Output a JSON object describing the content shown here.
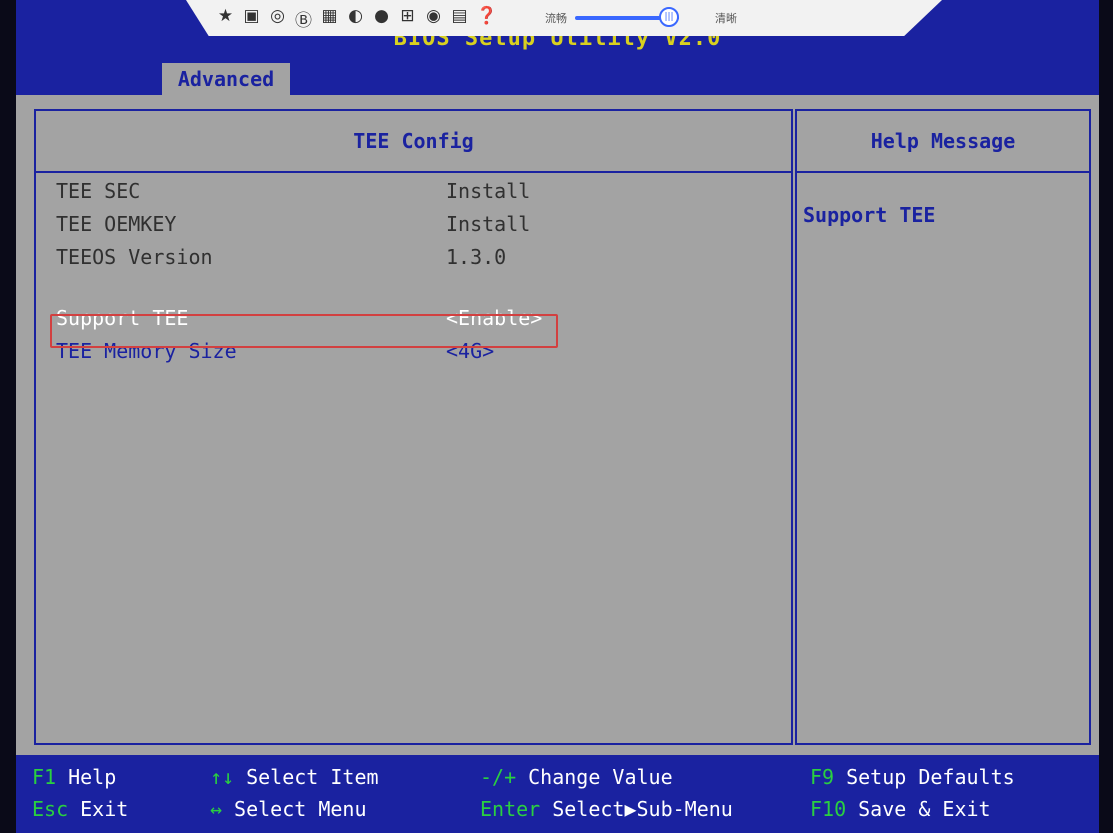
{
  "bios_title": "BIOS Setup Utility V2.0",
  "tab": "Advanced",
  "kvm": {
    "icons": [
      "pin-icon",
      "fullscreen-icon",
      "disc-icon",
      "b-icon",
      "keyboard-icon",
      "mouse-icon",
      "record-icon",
      "share-icon",
      "capture-icon",
      "screen-icon",
      "help-icon"
    ],
    "fluent_label": "流畅",
    "knob_label": "|||",
    "clear_label": "清晰"
  },
  "main": {
    "title": "TEE Config",
    "info_rows": [
      {
        "label": "TEE SEC",
        "value": "Install"
      },
      {
        "label": "TEE OEMKEY",
        "value": "Install"
      },
      {
        "label": "TEEOS Version",
        "value": "1.3.0"
      }
    ],
    "options": [
      {
        "label": "Support TEE",
        "value": "<Enable>"
      },
      {
        "label": "TEE Memory Size",
        "value": "<4G>"
      }
    ]
  },
  "help": {
    "title": "Help Message",
    "text": "Support TEE"
  },
  "footer": {
    "keys": [
      {
        "key": "F1",
        "action": "Help"
      },
      {
        "key": "↑↓",
        "action": "Select Item"
      },
      {
        "key": "-/+",
        "action": "Change Value"
      },
      {
        "key": "F9",
        "action": "Setup Defaults"
      },
      {
        "key": "Esc",
        "action": "Exit"
      },
      {
        "key": "↔",
        "action": "Select Menu"
      },
      {
        "key": "Enter",
        "action": "Select▶Sub-Menu"
      },
      {
        "key": "F10",
        "action": "Save & Exit"
      }
    ]
  },
  "colors": {
    "bios_blue": "#1a22a0",
    "panel_grey": "#a3a3a3",
    "key_green": "#2ad040",
    "highlight_red": "#d24040"
  }
}
